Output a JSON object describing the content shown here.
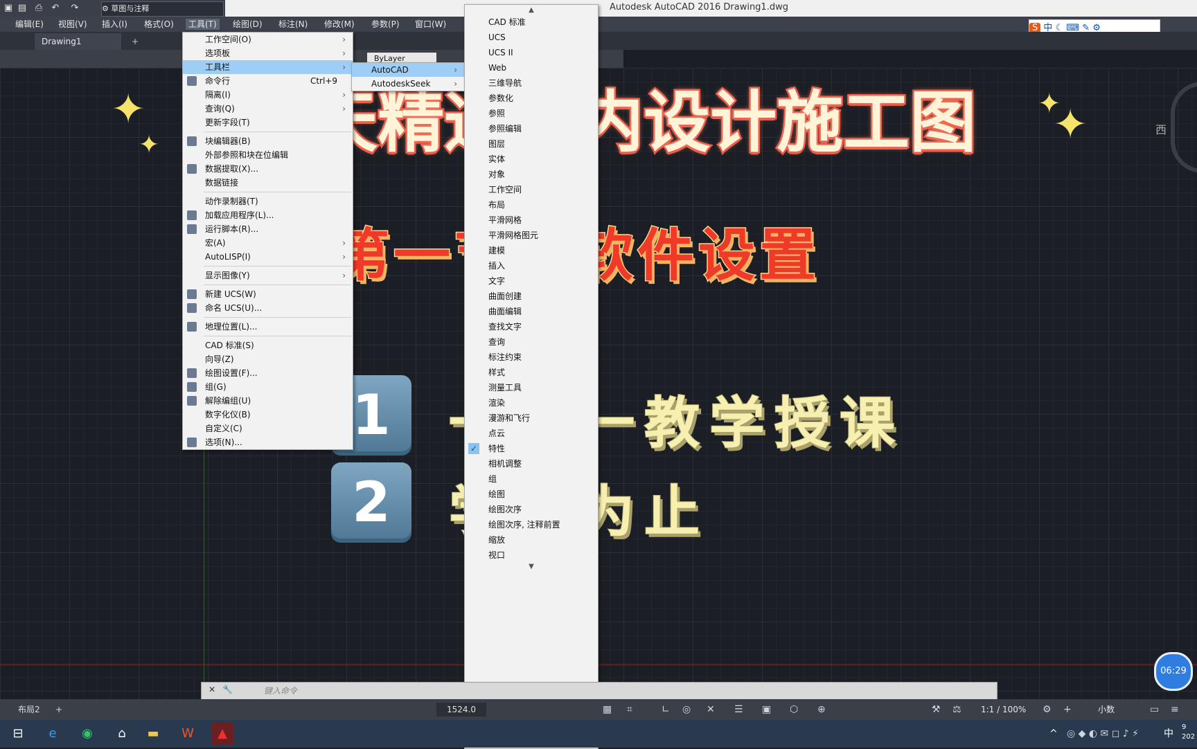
{
  "titlebar": {
    "workspace": "草图与注释",
    "app_title": "Autodesk AutoCAD 2016    Drawing1.dwg"
  },
  "menubar": {
    "items": [
      "编辑(E)",
      "视图(V)",
      "插入(I)",
      "格式(O)",
      "工具(T)",
      "绘图(D)",
      "标注(N)",
      "修改(M)",
      "参数(P)",
      "窗口(W)"
    ]
  },
  "tabs": {
    "doc": "Drawing1",
    "add": "+"
  },
  "toolrow": {
    "layer": "ByLayer"
  },
  "tools_menu": {
    "items": [
      {
        "label": "工作空间(O)",
        "arrow": "›"
      },
      {
        "label": "选项板",
        "arrow": "›"
      },
      {
        "label": "工具栏",
        "arrow": "›"
      },
      {
        "label": "命令行",
        "shortcut": "Ctrl+9"
      },
      {
        "label": "隔离(I)",
        "arrow": "›"
      },
      {
        "label": "查询(Q)",
        "arrow": "›"
      },
      {
        "label": "更新字段(T)"
      },
      {
        "label": "块编辑器(B)"
      },
      {
        "label": "外部参照和块在位编辑"
      },
      {
        "label": "数据提取(X)..."
      },
      {
        "label": "数据链接"
      },
      {
        "label": "动作录制器(T)"
      },
      {
        "label": "加载应用程序(L)..."
      },
      {
        "label": "运行脚本(R)..."
      },
      {
        "label": "宏(A)",
        "arrow": "›"
      },
      {
        "label": "AutoLISP(I)",
        "arrow": "›"
      },
      {
        "label": "显示图像(Y)",
        "arrow": "›"
      },
      {
        "label": "新建 UCS(W)"
      },
      {
        "label": "命名 UCS(U)..."
      },
      {
        "label": "地理位置(L)..."
      },
      {
        "label": "CAD 标准(S)"
      },
      {
        "label": "向导(Z)"
      },
      {
        "label": "绘图设置(F)..."
      },
      {
        "label": "组(G)"
      },
      {
        "label": "解除编组(U)"
      },
      {
        "label": "数字化仪(B)"
      },
      {
        "label": "自定义(C)"
      },
      {
        "label": "选项(N)..."
      }
    ]
  },
  "toolbar_submenu": {
    "items": [
      {
        "label": "AutoCAD",
        "arrow": "›"
      },
      {
        "label": "AutodeskSeek",
        "arrow": "›"
      }
    ]
  },
  "autocad_submenu": {
    "items": [
      "CAD 标准",
      "UCS",
      "UCS II",
      "Web",
      "三维导航",
      "参数化",
      "参照",
      "参照编辑",
      "图层",
      "实体",
      "对象",
      "工作空间",
      "布局",
      "平滑网格",
      "平滑网格图元",
      "建模",
      "插入",
      "文字",
      "曲面创建",
      "曲面编辑",
      "查找文字",
      "查询",
      "标注约束",
      "样式",
      "测量工具",
      "渲染",
      "漫游和飞行",
      "点云",
      "特性",
      "相机调整",
      "组",
      "绘图",
      "绘图次序",
      "绘图次序, 注释前置",
      "缩放",
      "视口"
    ],
    "checked": "特性"
  },
  "overlay": {
    "title": "15天精通室内设计施工图",
    "subtitle": "第一节：软件设置",
    "point1_num": "1",
    "point1_text": "一对一教学授课",
    "point2_num": "2",
    "point2_text": "学会为止"
  },
  "viewcube": {
    "west": "西"
  },
  "clock_bubble": "06:29",
  "cmdline": {
    "placeholder": "键入命令"
  },
  "status": {
    "layout": "布局2",
    "coords": "1524.0",
    "scale": "1:1 / 100%",
    "units": "小数"
  },
  "ime": "中",
  "taskbar": {
    "time": "9",
    "year": "202",
    "ime": "中"
  },
  "colors": {
    "accent": "#9ecdf5",
    "title_stroke": "#ef5a4a",
    "subtitle": "#ef3a2a",
    "point_text": "#f7efb0"
  }
}
